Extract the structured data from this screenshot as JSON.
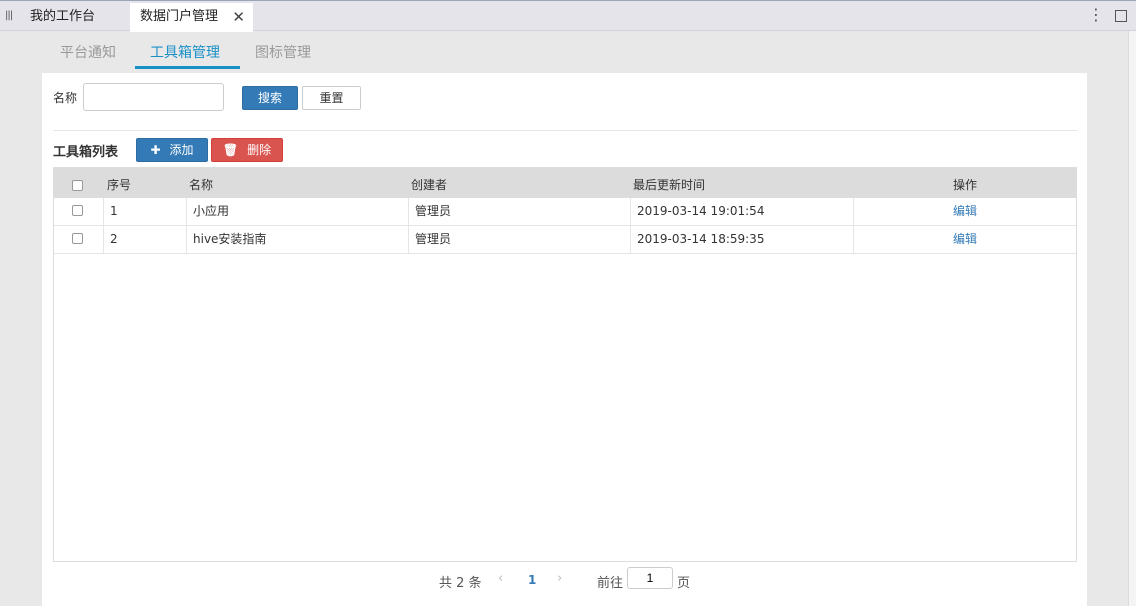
{
  "tabs": {
    "workbench": "我的工作台",
    "data_portal": "数据门户管理",
    "close_glyph": "✕"
  },
  "subtabs": [
    "平台通知",
    "工具箱管理",
    "图标管理"
  ],
  "search": {
    "label": "名称",
    "value": "",
    "placeholder": "",
    "search_btn": "搜索",
    "reset_btn": "重置"
  },
  "list": {
    "title": "工具箱列表",
    "add_btn": "添加",
    "delete_btn": "删除"
  },
  "icons": {
    "menu": "grip-icon",
    "more": "kebab-icon",
    "maximize": "maximize-icon",
    "add": "plus-icon",
    "delete": "trash-icon"
  },
  "table": {
    "headers": [
      "序号",
      "名称",
      "创建者",
      "最后更新时间",
      "操作"
    ],
    "rows": [
      {
        "index": "1",
        "name": "小应用",
        "creator": "管理员",
        "updated": "2019-03-14 19:01:54",
        "action": "编辑"
      },
      {
        "index": "2",
        "name": "hive安装指南",
        "creator": "管理员",
        "updated": "2019-03-14 18:59:35",
        "action": "编辑"
      }
    ]
  },
  "pager": {
    "total": "共 2 条",
    "prev": "‹",
    "current": "1",
    "next": "›",
    "goto_label": "前往",
    "goto_value": "1",
    "page_suffix": "页"
  },
  "colors": {
    "primary": "#337ab7",
    "danger": "#d9534f",
    "active_tab": "#1a90c7"
  }
}
